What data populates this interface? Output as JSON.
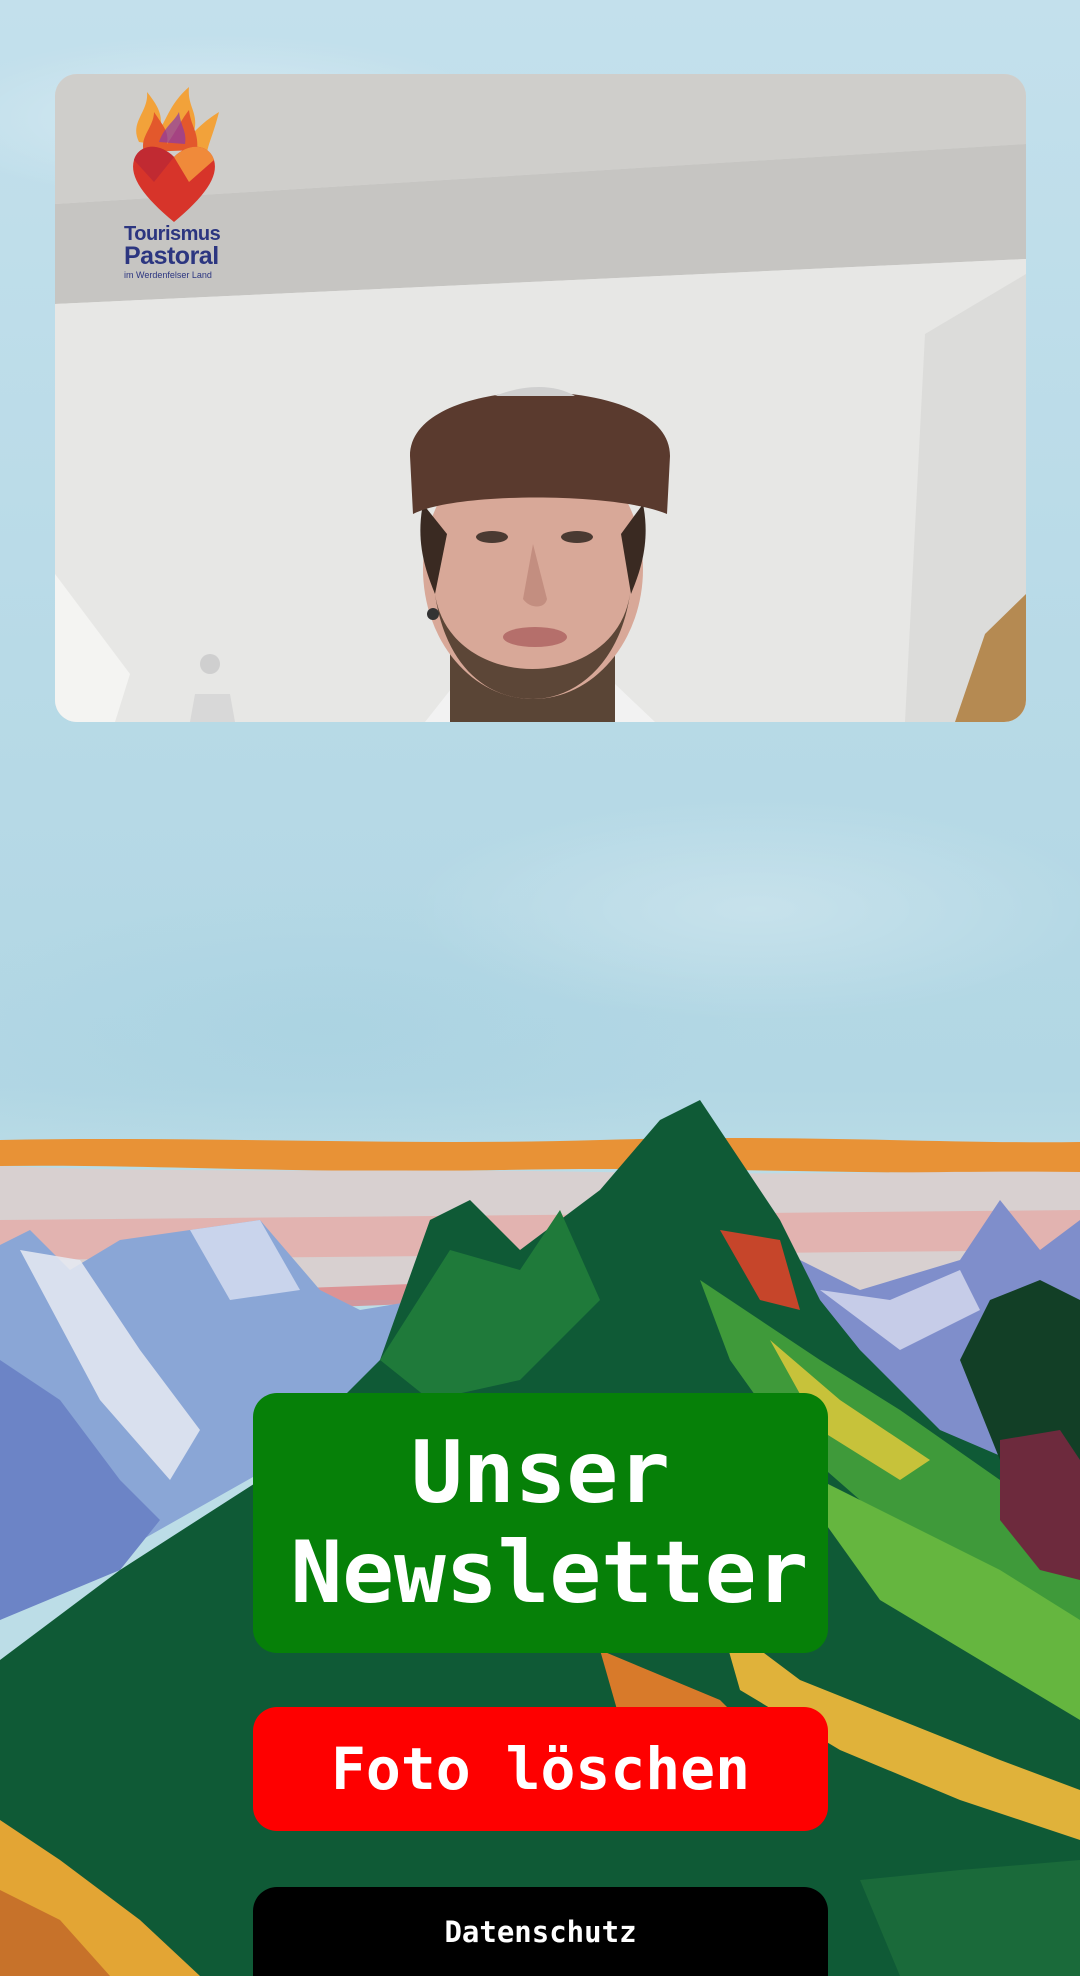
{
  "logo": {
    "line1": "Tourismus",
    "line2": "Pastoral",
    "line3": "im Werdenfelser Land"
  },
  "buttons": {
    "newsletter_label": "Unser Newsletter",
    "delete_photo_label": "Foto löschen",
    "privacy_label": "Datenschutz"
  },
  "colors": {
    "newsletter": "#068008",
    "delete": "#fe0000",
    "privacy": "#000000",
    "logo_text": "#2c3680"
  }
}
